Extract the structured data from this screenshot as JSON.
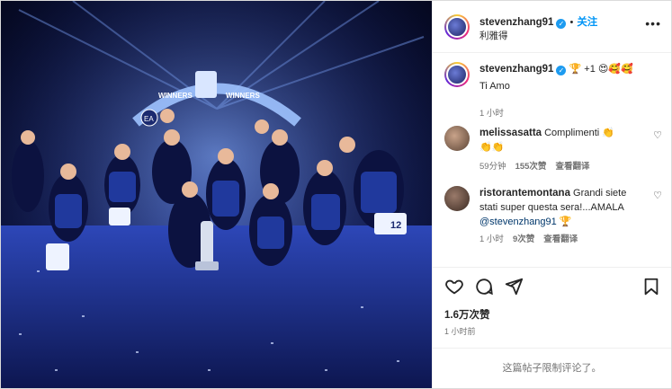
{
  "post": {
    "author": "stevenzhang91",
    "follow_label": "关注",
    "location": "利雅得",
    "separator": "•"
  },
  "photo": {
    "banner_text_left": "WINNERS",
    "banner_text_right": "WINNERS",
    "logo_text": "EA",
    "jersey_number": "12"
  },
  "caption": {
    "username": "stevenzhang91",
    "inline": "🏆 +1 😍🥰🥰",
    "text": "Ti Amo",
    "time": "1 小时"
  },
  "comments": [
    {
      "username": "melissasatta",
      "text": "Complimenti 👏",
      "text2": "👏👏",
      "time": "59分钟",
      "likes": "155次赞",
      "translate": "查看翻译"
    },
    {
      "username": "ristorantemontana",
      "text": "Grandi siete stati super questa sera!...AMALA",
      "mention": "@stevenzhang91",
      "trophy": "🏆",
      "time": "1 小时",
      "likes": "9次赞",
      "translate": "查看翻译"
    }
  ],
  "actions": {
    "like_icon": "heart-icon",
    "comment_icon": "comment-icon",
    "share_icon": "share-icon",
    "save_icon": "bookmark-icon"
  },
  "stats": {
    "likes": "1.6万次赞",
    "posted": "1 小时前"
  },
  "footer": {
    "limited_text": "这篇帖子限制评论了。"
  },
  "colors": {
    "accent": "#0095f6",
    "verified": "#1d9bf0",
    "muted": "#737373"
  }
}
